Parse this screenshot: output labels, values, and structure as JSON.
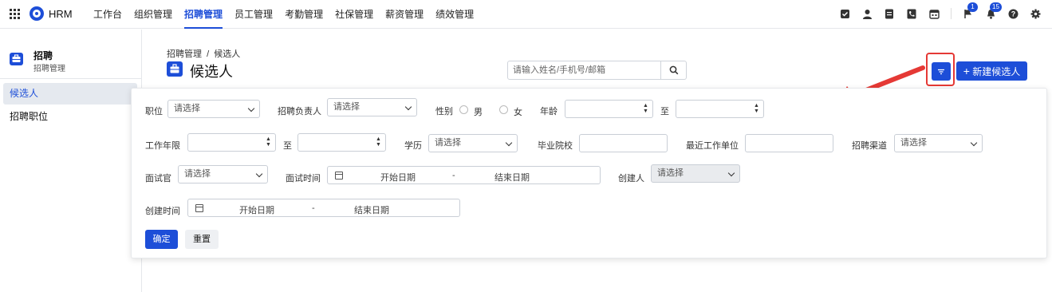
{
  "nav": {
    "brand": "HRM",
    "items": [
      "工作台",
      "组织管理",
      "招聘管理",
      "员工管理",
      "考勤管理",
      "社保管理",
      "薪资管理",
      "绩效管理"
    ],
    "active_index": 2,
    "badges": {
      "flag": "1",
      "bell": "15"
    },
    "icons": [
      "checkbox-icon",
      "user-icon",
      "document-icon",
      "phone-icon",
      "calendar-icon",
      "flag-icon",
      "bell-icon",
      "help-icon",
      "gear-icon"
    ]
  },
  "sidebar": {
    "title": "招聘",
    "subtitle": "招聘管理",
    "items": [
      {
        "label": "候选人",
        "active": true
      },
      {
        "label": "招聘职位",
        "active": false
      }
    ]
  },
  "header": {
    "breadcrumb": "招聘管理  /  候选人",
    "title": "候选人",
    "search_placeholder": "请输入姓名/手机号/邮箱",
    "new_button": "新建候选人"
  },
  "filters": {
    "position_label": "职位",
    "position_value": "请选择",
    "recruiter_label": "招聘负责人",
    "recruiter_value": "请选择",
    "gender_label": "性别",
    "gender_male": "男",
    "gender_female": "女",
    "age_label": "年龄",
    "to_1": "至",
    "work_years_label": "工作年限",
    "to_2": "至",
    "education_label": "学历",
    "education_value": "请选择",
    "school_label": "毕业院校",
    "last_company_label": "最近工作单位",
    "channel_label": "招聘渠道",
    "channel_value": "请选择",
    "interviewer_label": "面试官",
    "interviewer_value": "请选择",
    "interview_time_label": "面试时间",
    "start_date": "开始日期",
    "dash": "-",
    "end_date": "结束日期",
    "creator_label": "创建人",
    "creator_value": "请选择",
    "created_time_label": "创建时间",
    "created_start": "开始日期",
    "created_dash": "-",
    "created_end": "结束日期",
    "confirm": "确定",
    "reset": "重置"
  },
  "colors": {
    "primary": "#1d4ed8",
    "highlight": "#e53935"
  }
}
